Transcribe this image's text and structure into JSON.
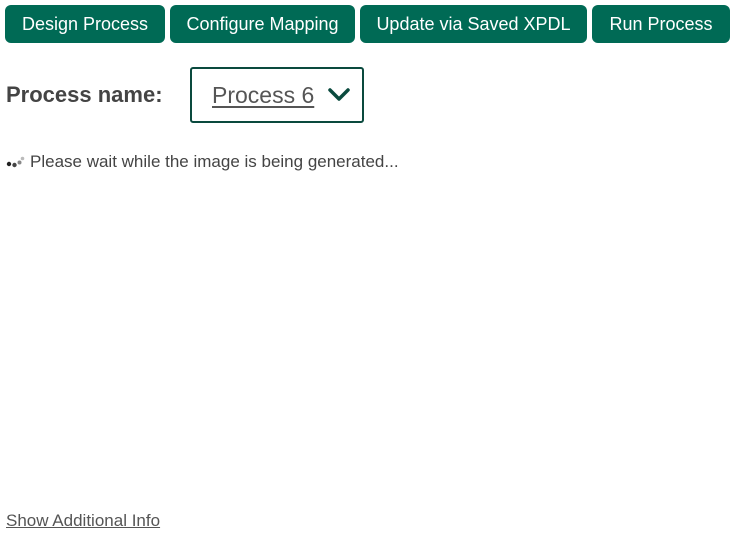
{
  "toolbar": {
    "design_label": "Design Process",
    "configure_label": "Configure Mapping",
    "update_label": "Update via Saved XPDL",
    "run_label": "Run Process"
  },
  "process": {
    "label": "Process name:",
    "selected": "Process 6"
  },
  "status": {
    "message": "Please wait while the image is being generated..."
  },
  "footer": {
    "additional_info_link": "Show Additional Info"
  },
  "colors": {
    "button_bg": "#006a55",
    "select_border": "#0a4a3e"
  },
  "icons": {
    "dropdown": "chevron-down-icon",
    "loading": "loading-spinner-icon"
  }
}
